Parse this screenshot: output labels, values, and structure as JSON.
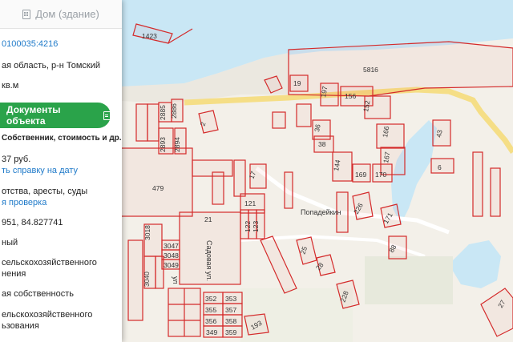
{
  "panel": {
    "header_label": "Дом (здание)",
    "cadastral_number": "0100035:4216",
    "region": "ая область, р-н Томский",
    "area": "кв.м",
    "documents_button": "Документы объекта",
    "documents_subtitle": "Собственник, стоимость и др.",
    "price": "37 руб.",
    "order_certificate_link": "ть справку на дату",
    "encumbrances": "отства, аресты, суды",
    "check_link": "я проверка",
    "coordinates": "951, 84.827741",
    "status": "ный",
    "land_category_line1": "сельскохозяйственного",
    "land_category_line2": "нения",
    "ownership": "ая собственность",
    "usage_line1": "ельскохозяйственного",
    "usage_line2": "ьзования"
  },
  "map": {
    "street_label": "Садовая ул.",
    "street_label_part": "ул",
    "village_label": "Попадейкин",
    "water_color": "#c9e7f5",
    "land_color": "#f2efe8",
    "parcel_color": "#d42a2a",
    "road_color": "#f7e39a",
    "parcel_labels": [
      "1423",
      "5816",
      "19",
      "197",
      "156",
      "152",
      "166",
      "167",
      "36",
      "38",
      "2885",
      "2886",
      "2893",
      "2894",
      "2",
      "144",
      "169",
      "170",
      "43",
      "6",
      "479",
      "121",
      "122",
      "123",
      "17",
      "21",
      "3018",
      "3047",
      "3048",
      "3049",
      "3040",
      "25",
      "28",
      "226",
      "171",
      "88",
      "352",
      "353",
      "355",
      "357",
      "356",
      "358",
      "349",
      "359",
      "193",
      "228",
      "27"
    ]
  }
}
